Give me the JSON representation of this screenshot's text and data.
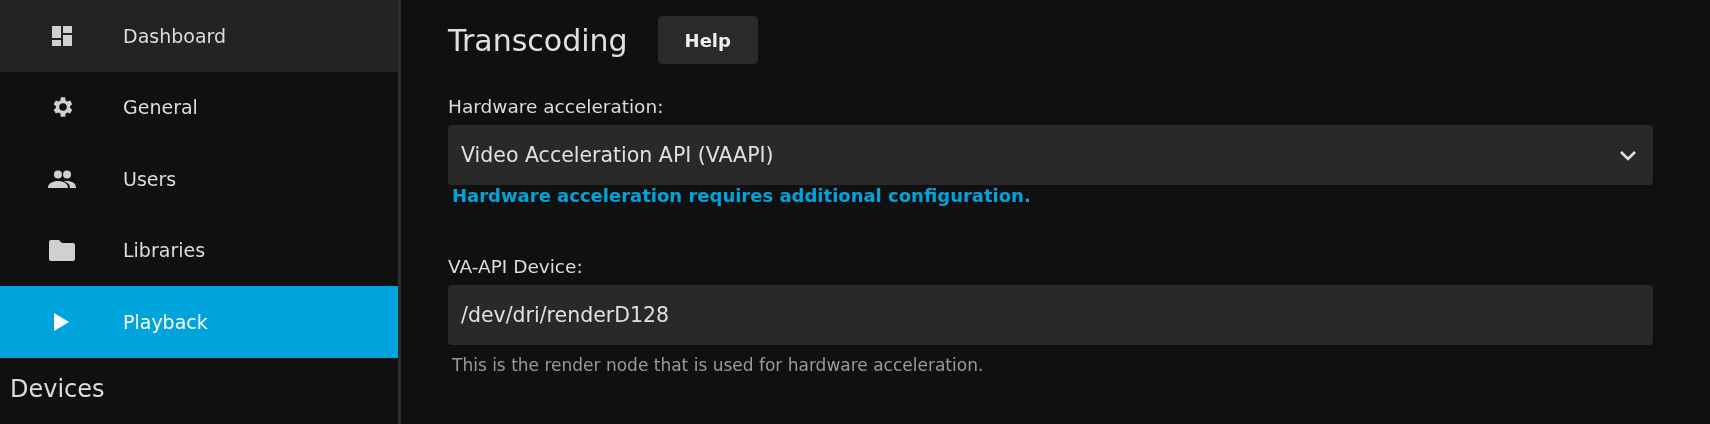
{
  "sidebar": {
    "items": [
      {
        "label": "Dashboard",
        "selected": false,
        "hovered": true
      },
      {
        "label": "General",
        "selected": false,
        "hovered": false
      },
      {
        "label": "Users",
        "selected": false,
        "hovered": false
      },
      {
        "label": "Libraries",
        "selected": false,
        "hovered": false
      },
      {
        "label": "Playback",
        "selected": true,
        "hovered": false
      }
    ],
    "section_header": "Devices"
  },
  "page": {
    "title": "Transcoding",
    "help_button": "Help",
    "hardware_acceleration": {
      "label": "Hardware acceleration:",
      "value": "Video Acceleration API (VAAPI)",
      "link": "Hardware acceleration requires additional configuration."
    },
    "vaapi_device": {
      "label": "VA-API Device:",
      "value": "/dev/dri/renderD128",
      "hint": "This is the render node that is used for hardware acceleration."
    }
  }
}
